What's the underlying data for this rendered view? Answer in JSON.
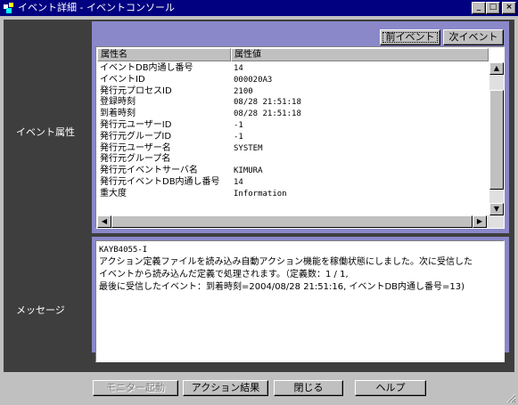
{
  "window": {
    "title": "イベント詳細 - イベントコンソール",
    "minimize": "_",
    "maximize": "□",
    "close": "×"
  },
  "attributes_section": {
    "label": "イベント属性",
    "prev_button": "前イベント",
    "next_button": "次イベント",
    "columns": [
      "属性名",
      "属性値"
    ],
    "rows": [
      {
        "name": "イベントDB内通し番号",
        "value": "14"
      },
      {
        "name": "イベントID",
        "value": "000020A3"
      },
      {
        "name": "発行元プロセスID",
        "value": "2100"
      },
      {
        "name": "登録時刻",
        "value": "08/28 21:51:18"
      },
      {
        "name": "到着時刻",
        "value": "08/28 21:51:18"
      },
      {
        "name": "発行元ユーザーID",
        "value": "-1"
      },
      {
        "name": "発行元グループID",
        "value": "-1"
      },
      {
        "name": "発行元ユーザー名",
        "value": "SYSTEM"
      },
      {
        "name": "発行元グループ名",
        "value": ""
      },
      {
        "name": "発行元イベントサーバ名",
        "value": "KIMURA"
      },
      {
        "name": "発行元イベントDB内通し番号",
        "value": "14"
      },
      {
        "name": "重大度",
        "value": "Information"
      }
    ]
  },
  "message_section": {
    "label": "メッセージ",
    "code": "KAYB4055-I",
    "lines": [
      "アクション定義ファイルを読み込み自動アクション機能を稼働状態にしました。次に受信した",
      "イベントから読み込んだ定義で処理されます。（定義数：1 / 1,",
      "最後に受信したイベント：到着時刻=2004/08/28 21:51:16, イベントDB内通し番号=13)"
    ]
  },
  "bottom_buttons": {
    "monitor": "モニター起動",
    "action_result": "アクション結果",
    "close": "閉じる",
    "help": "ヘルプ"
  },
  "colors": {
    "titlebar": "#000080",
    "frame": "#3e3e3e",
    "panel": "#8a88c9",
    "face": "#c0c0c0"
  }
}
